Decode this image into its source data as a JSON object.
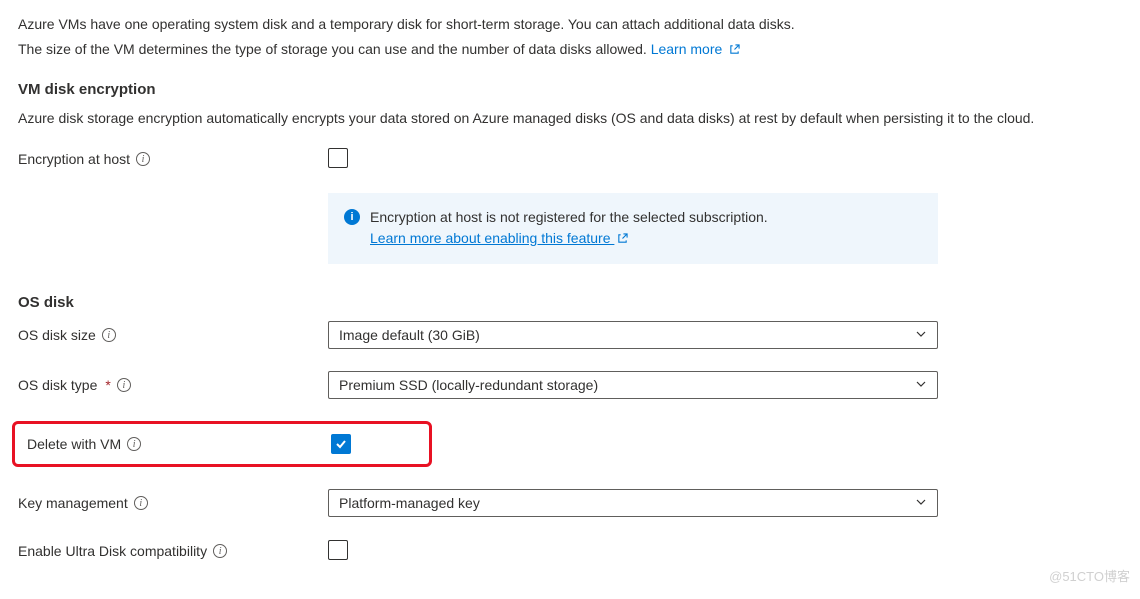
{
  "intro": {
    "line1": "Azure VMs have one operating system disk and a temporary disk for short-term storage. You can attach additional data disks.",
    "line2": "The size of the VM determines the type of storage you can use and the number of data disks allowed.",
    "learn_more": "Learn more"
  },
  "encryption": {
    "heading": "VM disk encryption",
    "description": "Azure disk storage encryption automatically encrypts your data stored on Azure managed disks (OS and data disks) at rest by default when persisting it to the cloud.",
    "at_host_label": "Encryption at host",
    "at_host_checked": false,
    "banner_text": "Encryption at host is not registered for the selected subscription.",
    "banner_link": "Learn more about enabling this feature"
  },
  "os_disk": {
    "heading": "OS disk",
    "size": {
      "label": "OS disk size",
      "value": "Image default (30 GiB)"
    },
    "type": {
      "label": "OS disk type",
      "required": "*",
      "value": "Premium SSD (locally-redundant storage)"
    },
    "delete_with_vm": {
      "label": "Delete with VM",
      "checked": true
    },
    "key_management": {
      "label": "Key management",
      "value": "Platform-managed key"
    },
    "ultra_disk": {
      "label": "Enable Ultra Disk compatibility",
      "checked": false
    }
  },
  "watermark": "@51CTO博客"
}
